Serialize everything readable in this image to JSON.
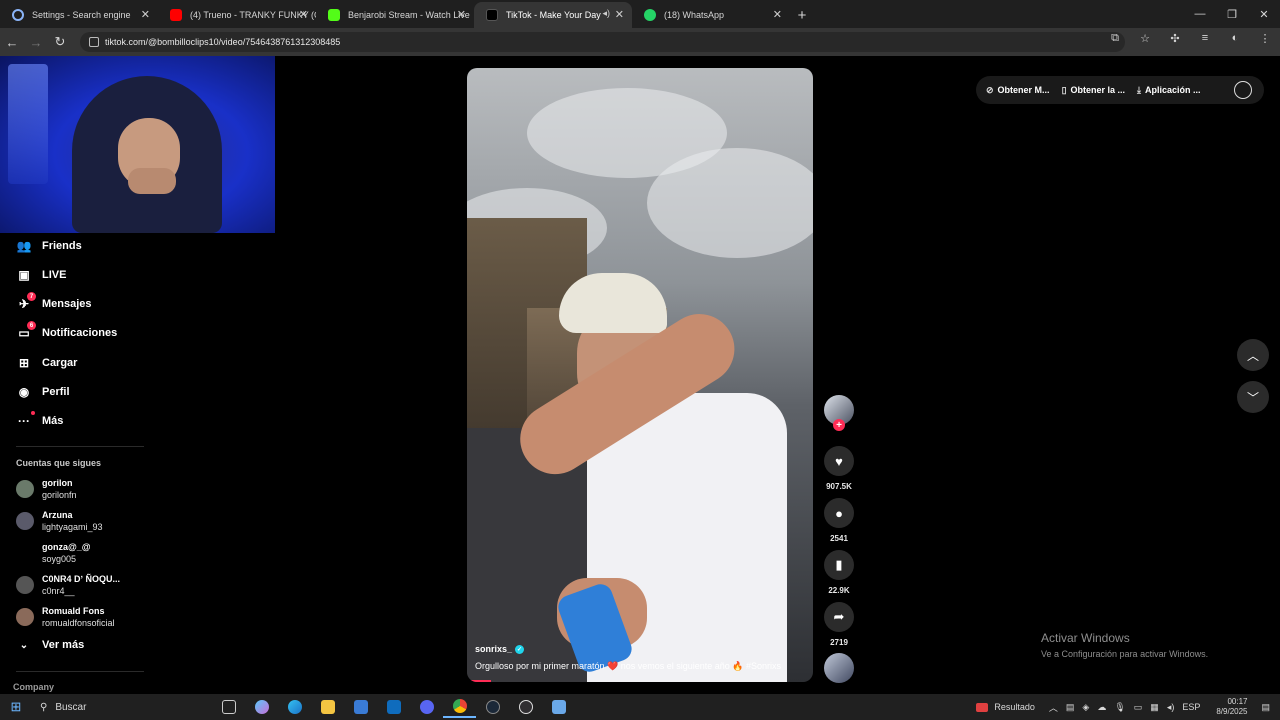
{
  "browser": {
    "tabs": [
      {
        "title": "Settings - Search engine",
        "color": "#8ab4f8",
        "active": false
      },
      {
        "title": "(4) Trueno - TRANKY FUNKY (O",
        "color": "#ff0000",
        "active": false
      },
      {
        "title": "Benjarobi Stream - Watch Live",
        "color": "#53fc18",
        "active": false
      },
      {
        "title": "TikTok - Make Your Day",
        "color": "#ffffff",
        "active": true
      },
      {
        "title": "(18) WhatsApp",
        "color": "#25d366",
        "active": false
      }
    ],
    "url": "tiktok.com/@bombilloclips10/video/7546438761312308485"
  },
  "sidebar": {
    "items": [
      {
        "label": "Friends",
        "icon": "friends-icon",
        "glyph": "👥"
      },
      {
        "label": "LIVE",
        "icon": "live-icon",
        "glyph": "▣"
      },
      {
        "label": "Mensajes",
        "icon": "messages-icon",
        "glyph": "✈",
        "badge": "7"
      },
      {
        "label": "Notificaciones",
        "icon": "notifications-icon",
        "glyph": "▭",
        "badge": "6"
      },
      {
        "label": "Cargar",
        "icon": "upload-icon",
        "glyph": "⊞"
      },
      {
        "label": "Perfil",
        "icon": "profile-icon",
        "glyph": "◉"
      },
      {
        "label": "Más",
        "icon": "more-icon",
        "glyph": "···",
        "dot": true
      }
    ],
    "following_title": "Cuentas que sigues",
    "following": [
      {
        "name": "gorilon",
        "handle": "gorilonfn"
      },
      {
        "name": "Arzuna",
        "handle": "lightyagami_93"
      },
      {
        "name": "gonza@_@",
        "handle": "soyg005"
      },
      {
        "name": "C0NR4 Dʼ ÑOQU...",
        "handle": "c0nr4__"
      },
      {
        "name": "Romuald Fons",
        "handle": "romualdfonsoficial"
      }
    ],
    "see_more": "Ver más",
    "company": "Company"
  },
  "video": {
    "username": "sonrixs_",
    "caption": "Orgulloso por mi primer maratón ❤️ nos vemos el siguiente año 🔥 #Sonrixs",
    "progress": 0.07
  },
  "actions": {
    "likes": "907.5K",
    "comments": "2541",
    "saves": "22.9K",
    "shares": "2719"
  },
  "top_pills": [
    {
      "label": "Obtener M...",
      "icon": "coin-icon",
      "glyph": "⊘"
    },
    {
      "label": "Obtener la ...",
      "icon": "phone-icon",
      "glyph": "▯"
    },
    {
      "label": "Aplicación ...",
      "icon": "download-icon",
      "glyph": "⤓"
    }
  ],
  "watermark": {
    "line1": "Activar Windows",
    "line2": "Ve a Configuración para activar Windows."
  },
  "taskbar": {
    "search_placeholder": "Buscar",
    "weather": "Resultado",
    "lang": "ESP",
    "time": "00:17",
    "date": "8/9/2025"
  }
}
